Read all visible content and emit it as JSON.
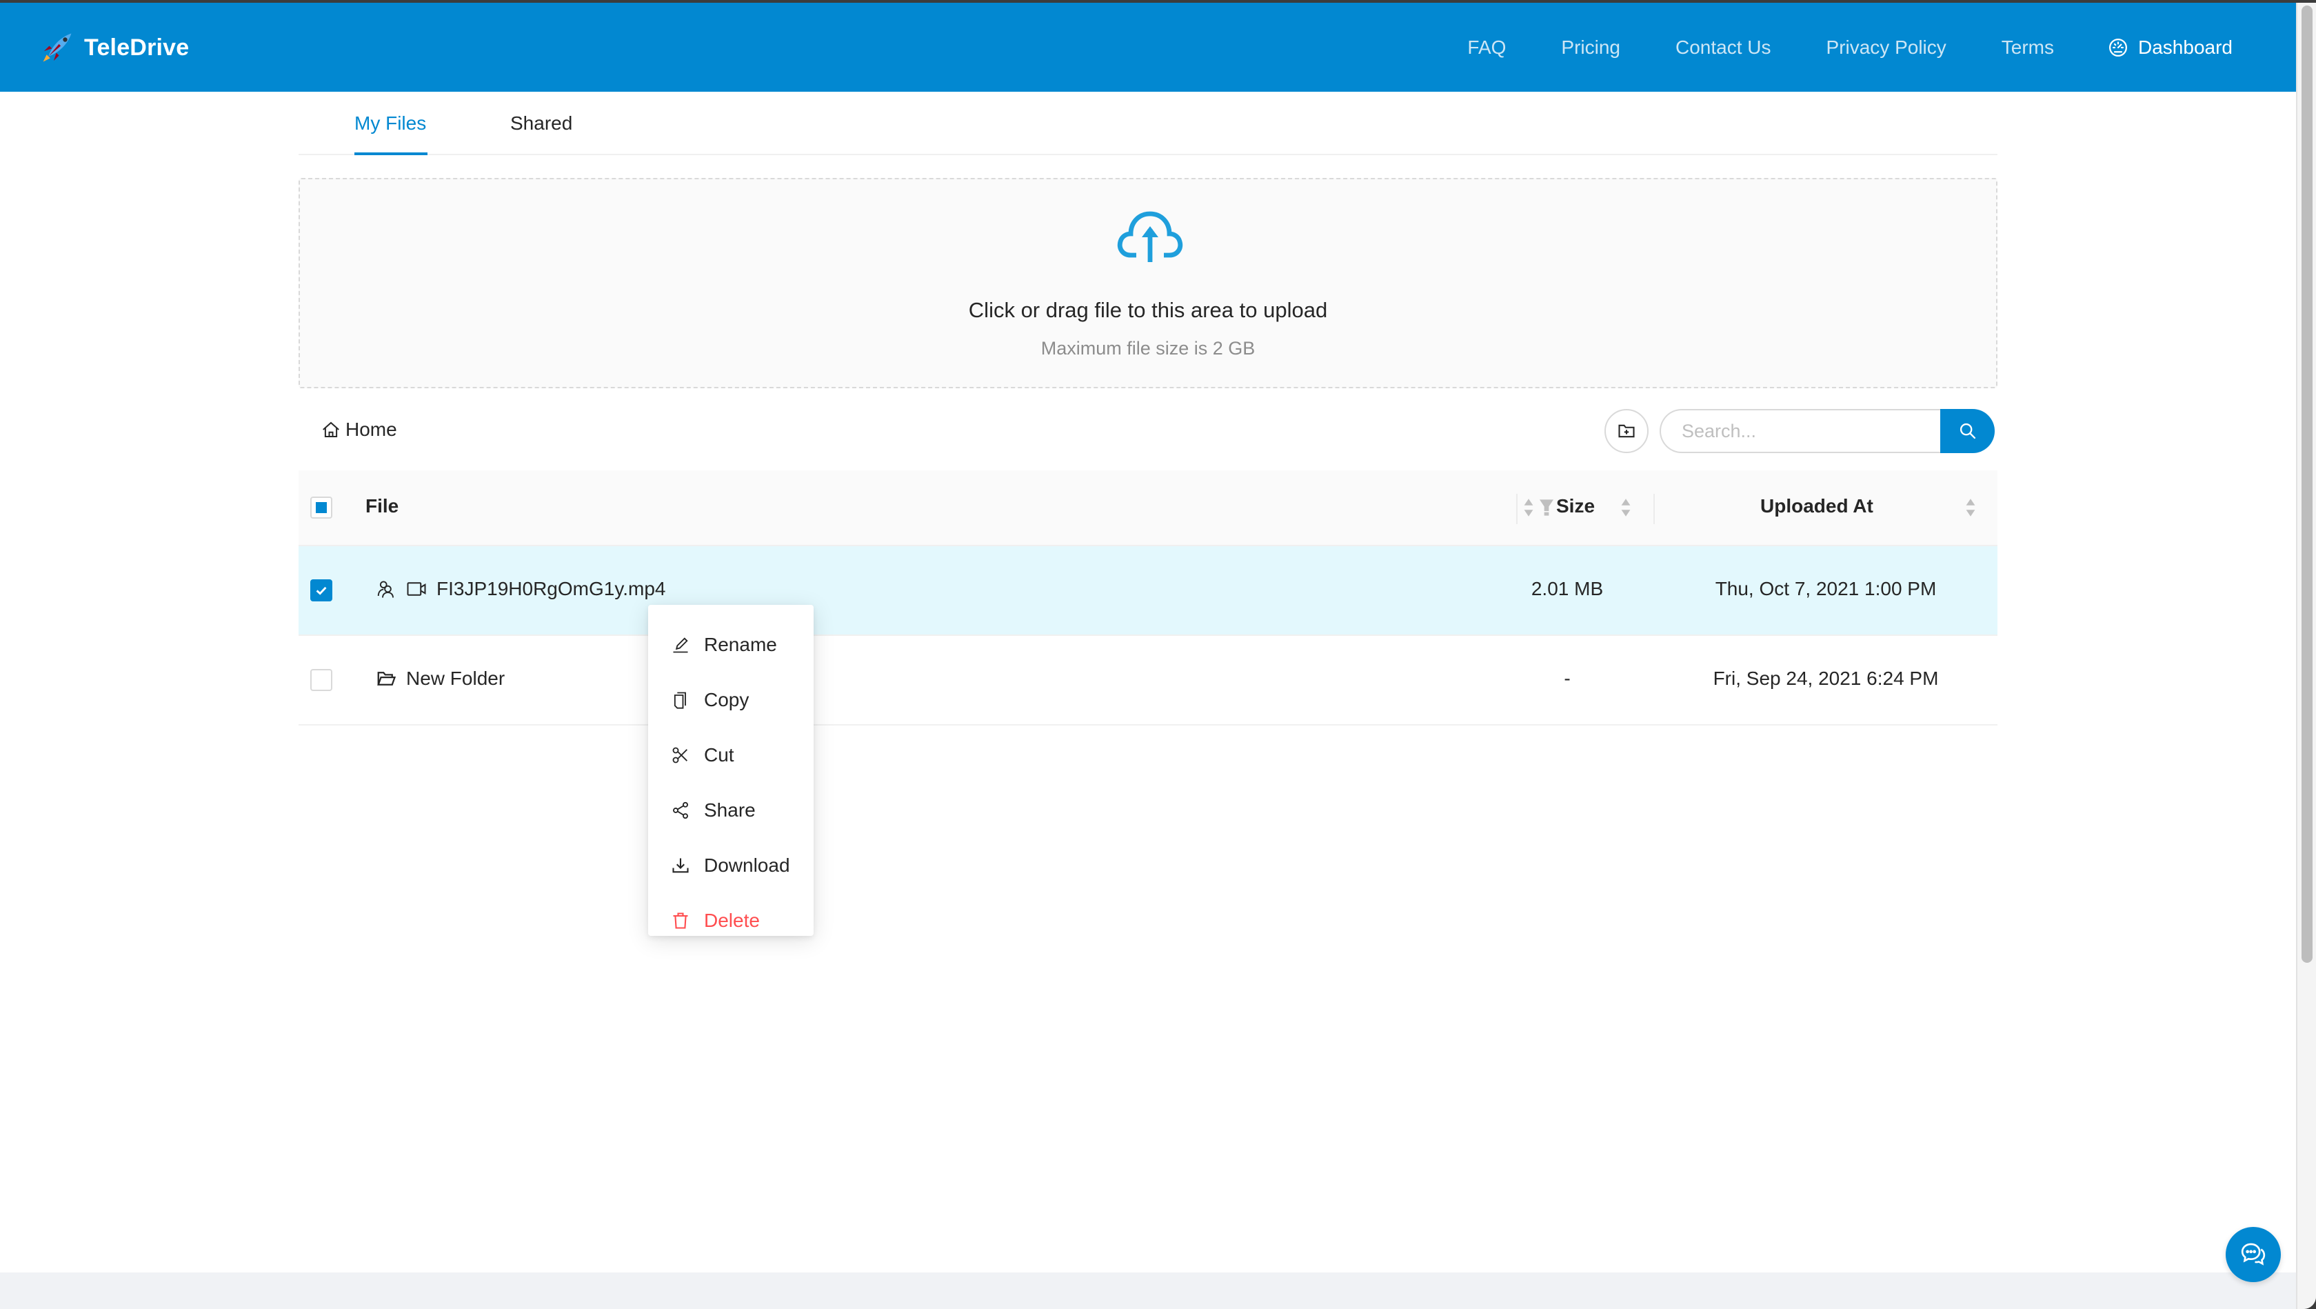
{
  "header": {
    "brand": "TeleDrive",
    "nav": [
      {
        "label": "FAQ"
      },
      {
        "label": "Pricing"
      },
      {
        "label": "Contact Us"
      },
      {
        "label": "Privacy Policy"
      },
      {
        "label": "Terms"
      }
    ],
    "dashboard_label": "Dashboard",
    "colors": {
      "bar": "#0288d1",
      "accent": "#0288d1",
      "danger": "#ff4d4f",
      "selected_row": "#e3f8fd"
    }
  },
  "tabs": [
    {
      "label": "My Files",
      "active": true
    },
    {
      "label": "Shared",
      "active": false
    }
  ],
  "upload": {
    "title": "Click or drag file to this area to upload",
    "hint": "Maximum file size is 2 GB",
    "icon": "cloud-upload-icon"
  },
  "breadcrumb": {
    "home_label": "Home"
  },
  "search": {
    "placeholder": "Search...",
    "value": ""
  },
  "table": {
    "columns": [
      {
        "label": "File",
        "sortable": true,
        "filterable": true
      },
      {
        "label": "Size",
        "sortable": true
      },
      {
        "label": "Uploaded At",
        "sortable": true
      }
    ],
    "header_checkbox": "indeterminate",
    "rows": [
      {
        "name": "FI3JP19H0RgOmG1y.mp4",
        "type": "video",
        "shared": true,
        "size": "2.01 MB",
        "uploaded_at": "Thu, Oct 7, 2021 1:00 PM",
        "selected": true
      },
      {
        "name": "New Folder",
        "type": "folder",
        "shared": false,
        "size": "-",
        "uploaded_at": "Fri, Sep 24, 2021 6:24 PM",
        "selected": false
      }
    ]
  },
  "context_menu": {
    "items": [
      {
        "label": "Rename",
        "icon": "edit-icon"
      },
      {
        "label": "Copy",
        "icon": "copy-icon"
      },
      {
        "label": "Cut",
        "icon": "scissor-icon"
      },
      {
        "label": "Share",
        "icon": "share-icon"
      },
      {
        "label": "Download",
        "icon": "download-icon"
      },
      {
        "label": "Delete",
        "icon": "delete-icon",
        "danger": true
      }
    ]
  }
}
